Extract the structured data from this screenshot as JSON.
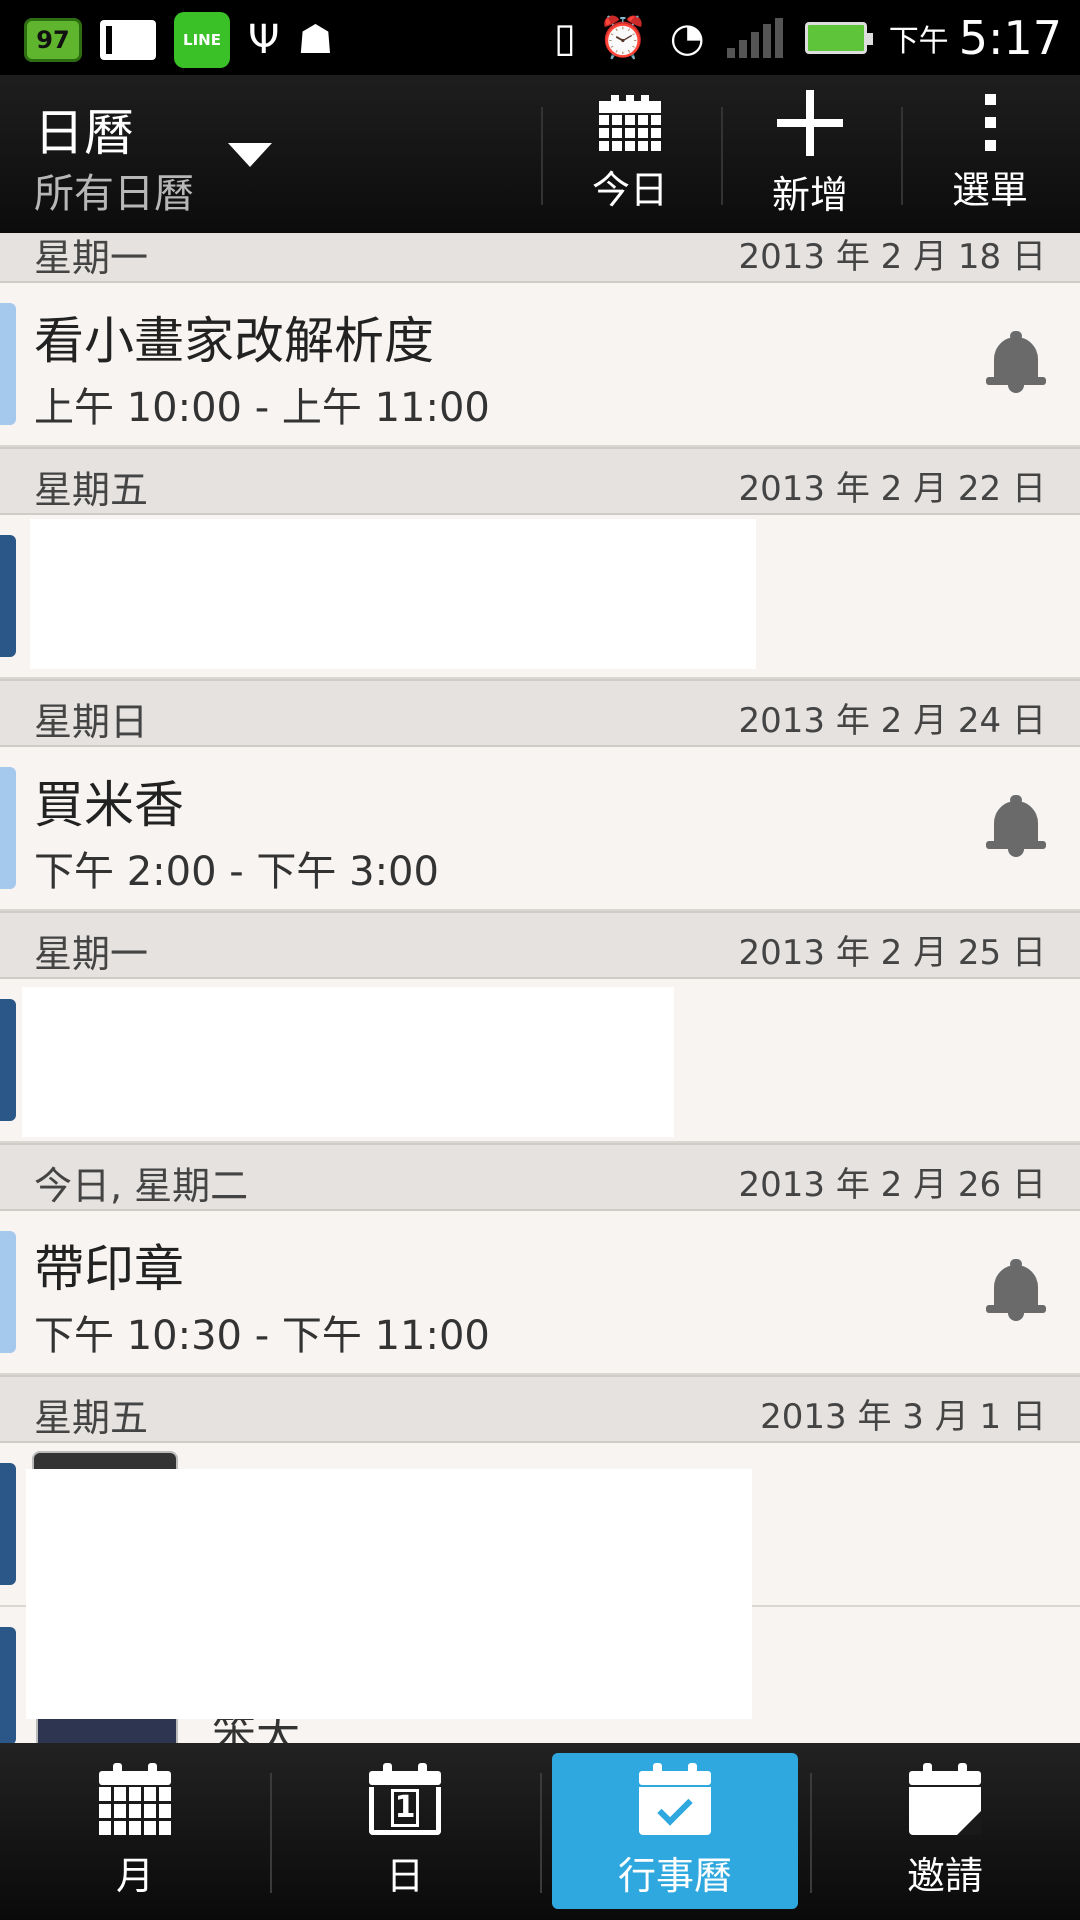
{
  "status_bar": {
    "badge_count": "97",
    "line_label": "LINE",
    "ampm": "下午",
    "time": "5:17"
  },
  "action_bar": {
    "title": "日曆",
    "subtitle": "所有日曆",
    "today_label": "今日",
    "add_label": "新增",
    "menu_label": "選單"
  },
  "agenda": [
    {
      "day": "星期一",
      "date": "2013 年 2 月 18 日"
    },
    {
      "title": "看小畫家改解析度",
      "time": "上午 10:00 - 上午 11:00",
      "color": "#a5c9ec"
    },
    {
      "day": "星期五",
      "date": "2013 年 2 月 22 日"
    },
    {
      "day": "星期日",
      "date": "2013 年 2 月 24 日"
    },
    {
      "title": "買米香",
      "time": "下午 2:00 - 下午 3:00",
      "color": "#a5c9ec"
    },
    {
      "day": "星期一",
      "date": "2013 年 2 月 25 日"
    },
    {
      "day": "今日, 星期二",
      "date": "2013 年 2 月 26 日"
    },
    {
      "title": "帶印章",
      "time": "下午 10:30 - 下午 11:00",
      "color": "#a5c9ec"
    },
    {
      "day": "星期五",
      "date": "2013 年 3 月 1 日"
    },
    {
      "partial_text": "笨大"
    }
  ],
  "bottom_nav": {
    "month_label": "月",
    "day_label": "日",
    "agenda_label": "行事曆",
    "invite_label": "邀請",
    "active": "agenda",
    "active_color": "#2ea8de"
  }
}
